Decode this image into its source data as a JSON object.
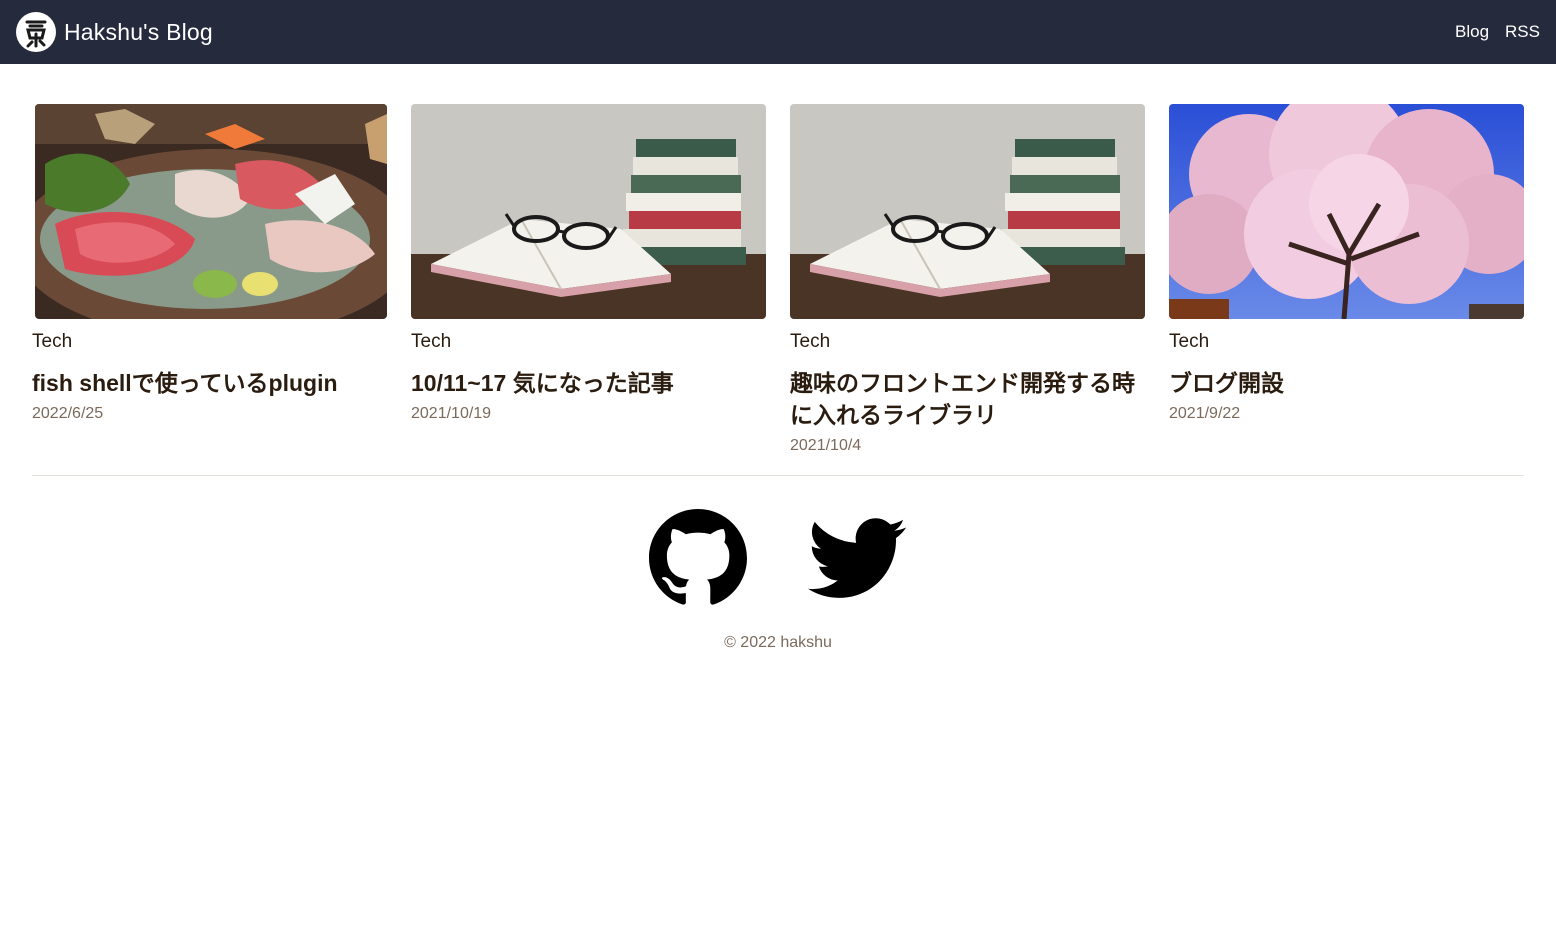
{
  "header": {
    "title": "Hakshu's Blog",
    "nav": [
      {
        "label": "Blog"
      },
      {
        "label": "RSS"
      }
    ]
  },
  "posts": [
    {
      "category": "Tech",
      "title": "fish shellで使っているplugin",
      "date": "2022/6/25",
      "image": "sashimi-platter"
    },
    {
      "category": "Tech",
      "title": "10/11~17 気になった記事",
      "date": "2021/10/19",
      "image": "books-with-glasses"
    },
    {
      "category": "Tech",
      "title": "趣味のフロントエンド開発する時に入れるライブラリ",
      "date": "2021/10/4",
      "image": "books-with-glasses"
    },
    {
      "category": "Tech",
      "title": "ブログ開設",
      "date": "2021/9/22",
      "image": "cherry-blossom-tree"
    }
  ],
  "footer": {
    "icons": [
      "github-icon",
      "twitter-icon"
    ],
    "copyright": "© 2022 hakshu"
  },
  "colors": {
    "navbar": "#262a3d",
    "text": "#2b1c10",
    "muted": "#7b6a5c"
  }
}
